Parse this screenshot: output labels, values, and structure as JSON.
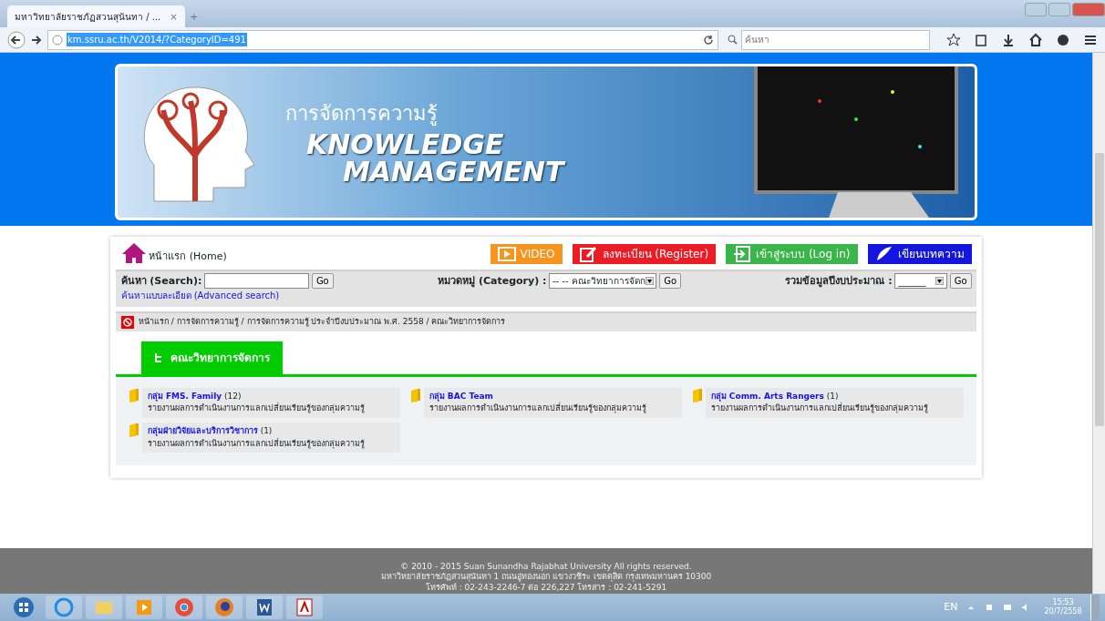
{
  "browser": {
    "tab_title": "มหาวิทยาลัยราชภัฏสวนสุนันทา / ...",
    "tab_close": "×",
    "new_tab": "+",
    "url": "km.ssru.ac.th/V2014/?CategoryID=491",
    "search_placeholder": "ค้นหา"
  },
  "banner": {
    "subtitle": "การจัดการความรู้",
    "title_lines": [
      "KNOWLEDGE",
      "MANAGEMENT"
    ]
  },
  "nav": {
    "home": "หน้าแรก (Home)",
    "buttons": [
      {
        "kind": "video",
        "label": "VIDEO",
        "color": "#f7941d"
      },
      {
        "kind": "register",
        "label": "ลงทะเบียน (Register)",
        "color": "#ed1c24"
      },
      {
        "kind": "login",
        "label": "เข้าสู่ระบบ (Log in)",
        "color": "#39b54a"
      },
      {
        "kind": "write",
        "label": "เขียนบทความ",
        "color": "#1515e0"
      }
    ]
  },
  "search": {
    "label": "ค้นหา (Search):",
    "go": "Go",
    "advanced": "ค้นหาแบบละเอียด (Advanced search)",
    "category_label": "หมวดหมู่ (Category) :",
    "category_value": "-- -- คณะวิทยาการจัดก",
    "category_go": "Go",
    "budget_label": "รวมข้อมูลปีงบประมาณ :",
    "budget_value": "______",
    "budget_go": "Go"
  },
  "breadcrumb": "หน้าแรก / การจัดการความรู้ / การจัดการความรู้ ประจำปีงบประมาณ พ.ศ. 2558 / คณะวิทยาการจัดการ",
  "section_tab": "คณะวิทยาการจัดการ",
  "groups": [
    {
      "name": "กลุ่ม FMS. Family",
      "count": "(12)",
      "description": "รายงานผลการดำเนินงานการแลกเปลี่ยนเรียนรู้ของกลุ่มความรู้"
    },
    {
      "name": "กลุ่ม BAC Team",
      "description": "รายงานผลการดำเนินงานการแลกเปลี่ยนเรียนรู้ของกลุ่มความรู้"
    },
    {
      "name": "กลุ่ม Comm. Arts Rangers",
      "count": "(1)",
      "description": "รายงานผลการดำเนินงานการแลกเปลี่ยนเรียนรู้ของกลุ่มความรู้"
    },
    {
      "name": "กลุ่มฝ่ายวิจัยและบริการวิชาการ",
      "count": "(1)",
      "description": "รายงานผลการดำเนินงานการแลกเปลี่ยนเรียนรู้ของกลุ่มความรู้"
    }
  ],
  "footer": [
    "© 2010 - 2015 Suan Sunandha Rajabhat University All rights reserved.",
    "มหาวิทยาลัยราชภัฏสวนสุนันทา 1 ถนนอู่ทองนอก แขวงวชิระ เขตดุสิต กรุงเทพมหานคร 10300",
    "โทรศัพท์ : 02-243-2246-7 ต่อ 226,227 โทรสาร : 02-241-5291"
  ],
  "taskbar": {
    "language": "EN",
    "time": "15:53",
    "date": "20/7/2558"
  }
}
